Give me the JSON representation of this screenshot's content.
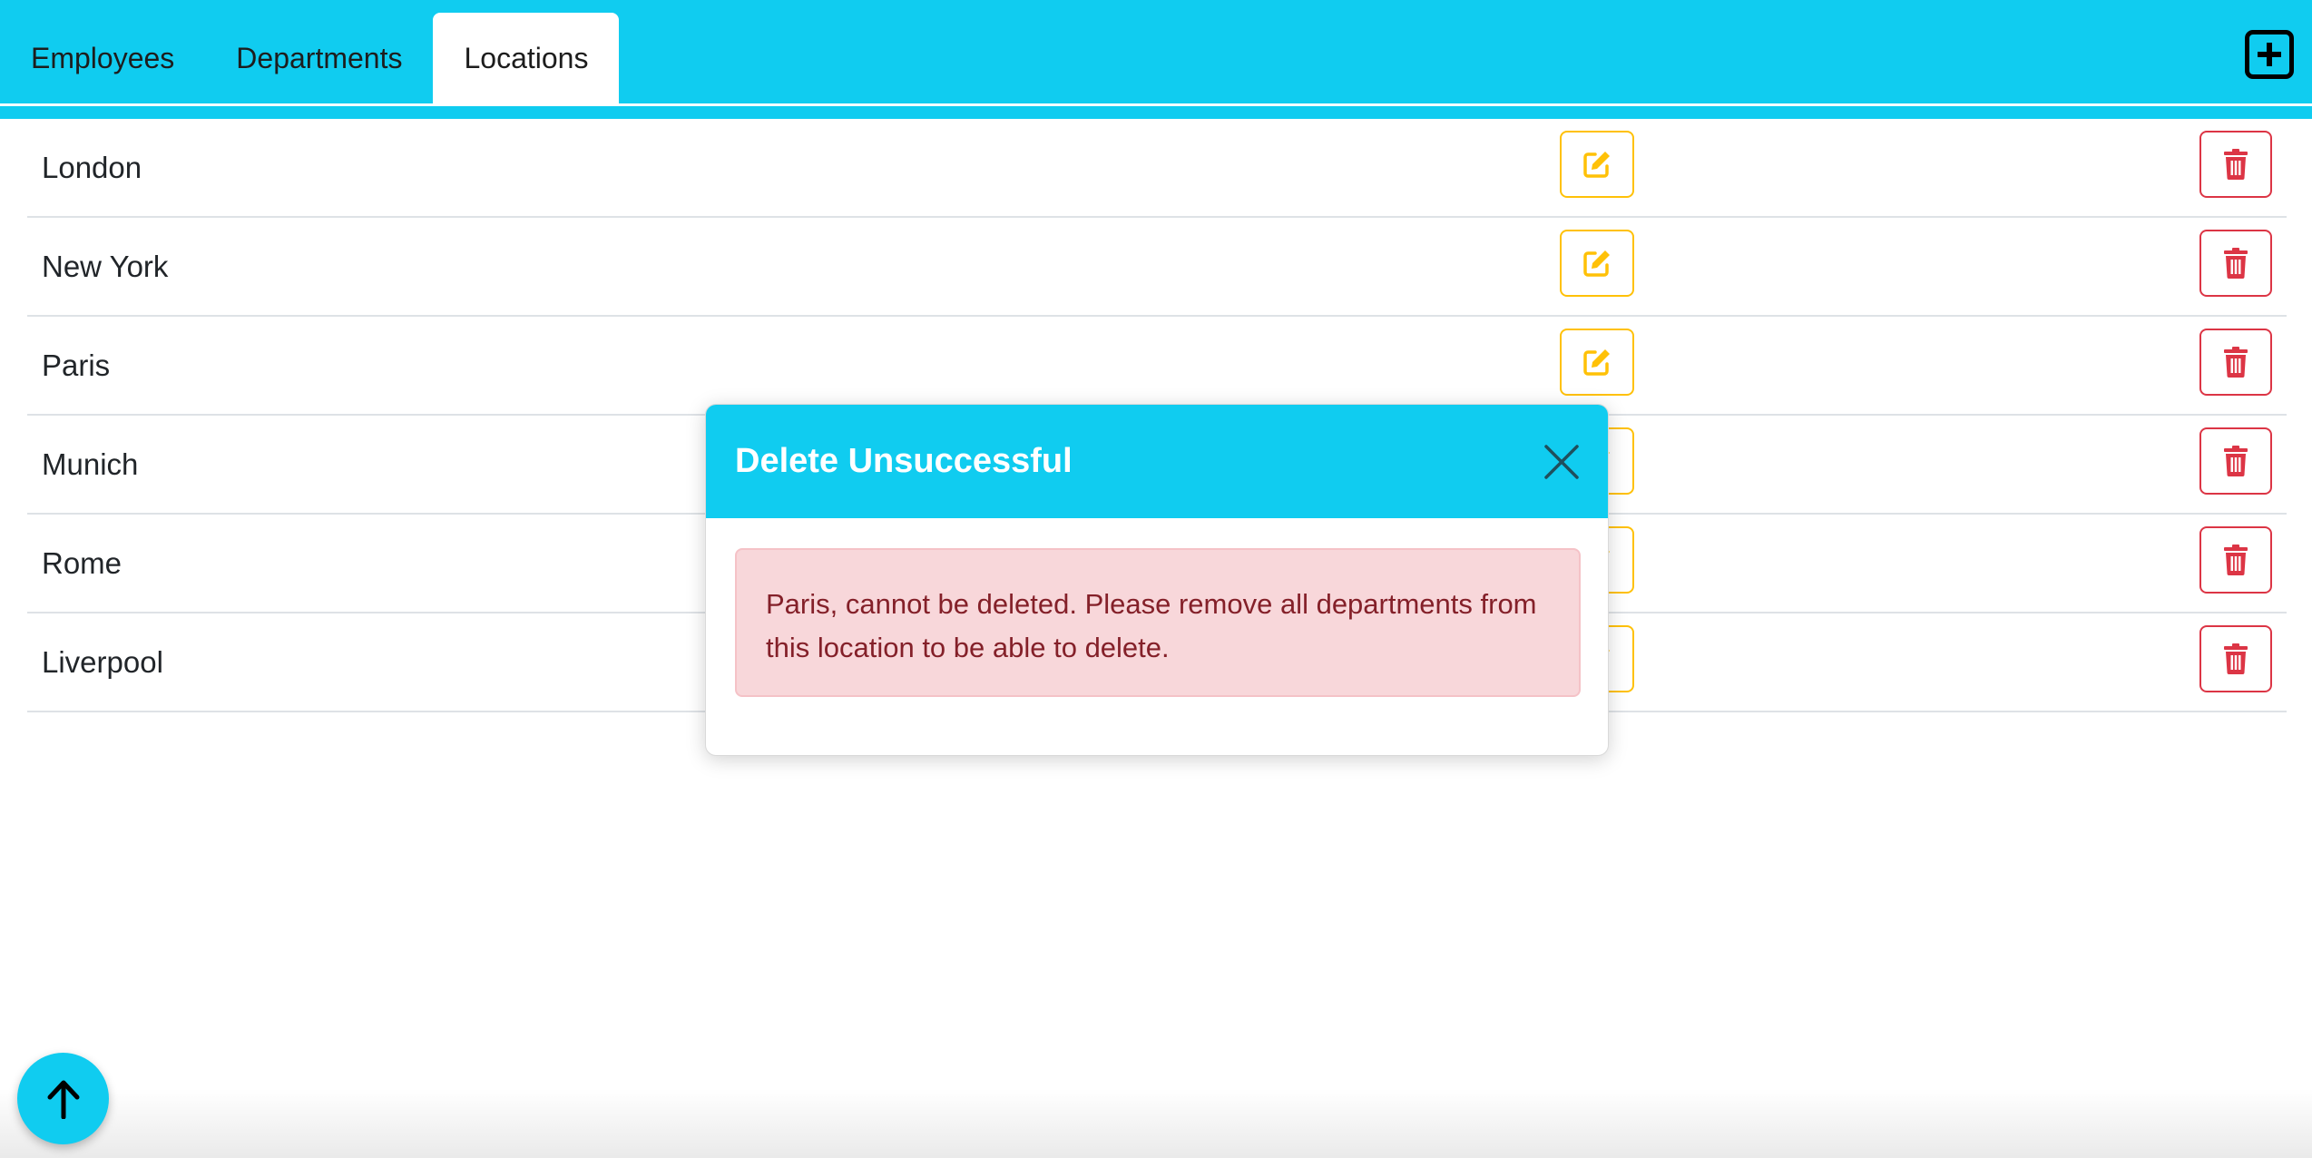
{
  "tabs": [
    {
      "label": "Employees",
      "active": false
    },
    {
      "label": "Departments",
      "active": false
    },
    {
      "label": "Locations",
      "active": true
    }
  ],
  "header": {
    "add_icon": "plus-square-icon"
  },
  "locations": [
    {
      "name": "London"
    },
    {
      "name": "New York"
    },
    {
      "name": "Paris"
    },
    {
      "name": "Munich"
    },
    {
      "name": "Rome"
    },
    {
      "name": "Liverpool"
    }
  ],
  "row_actions": {
    "edit_icon": "edit-icon",
    "delete_icon": "trash-icon"
  },
  "modal": {
    "title": "Delete Unsuccessful",
    "message": "Paris, cannot be deleted. Please remove all departments from this location to be able to delete.",
    "close_icon": "close-icon"
  },
  "scroll_top": {
    "icon": "arrow-up-icon"
  },
  "colors": {
    "primary": "#10ccf0",
    "edit": "#ffc107",
    "delete": "#dc3545",
    "alert_bg": "#f8d7da",
    "alert_text": "#842029"
  }
}
